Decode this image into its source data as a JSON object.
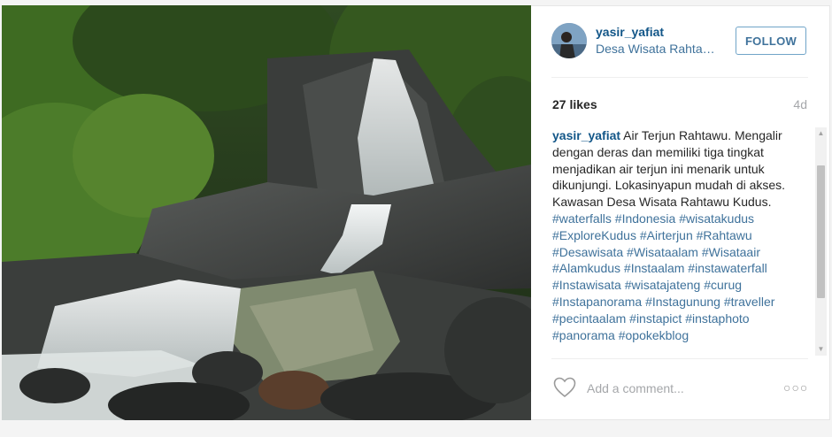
{
  "post": {
    "username": "yasir_yafiat",
    "location": "Desa Wisata Rahta…",
    "follow_label": "FOLLOW",
    "likes": "27 likes",
    "time": "4d",
    "caption_user": "yasir_yafiat",
    "caption_text": " Air Terjun Rahtawu. Mengalir dengan deras dan memiliki tiga tingkat menjadikan air terjun ini menarik untuk dikunjungi. Lokasinyapun mudah di akses. Kawasan Desa Wisata Rahtawu Kudus.",
    "hashtags": "#waterfalls #Indonesia #wisatakudus #ExploreKudus #Airterjun #Rahtawu #Desawisata #Wisataalam #Wisataair #Alamkudus #Instaalam #instawaterfall #Instawisata #wisatajateng #curug #Instapanorama #Instagunung #traveller #pecintaalam #instapict #instaphoto #panorama #opokekblog",
    "comment_placeholder": "Add a comment...",
    "more_label": "○○○"
  },
  "icons": {
    "heart": "heart-icon",
    "more": "more-options-icon",
    "avatar": "avatar"
  },
  "colors": {
    "link": "#125688",
    "tag": "#3f729b",
    "follow_border": "#70a4c8",
    "muted": "#a5a7aa"
  }
}
